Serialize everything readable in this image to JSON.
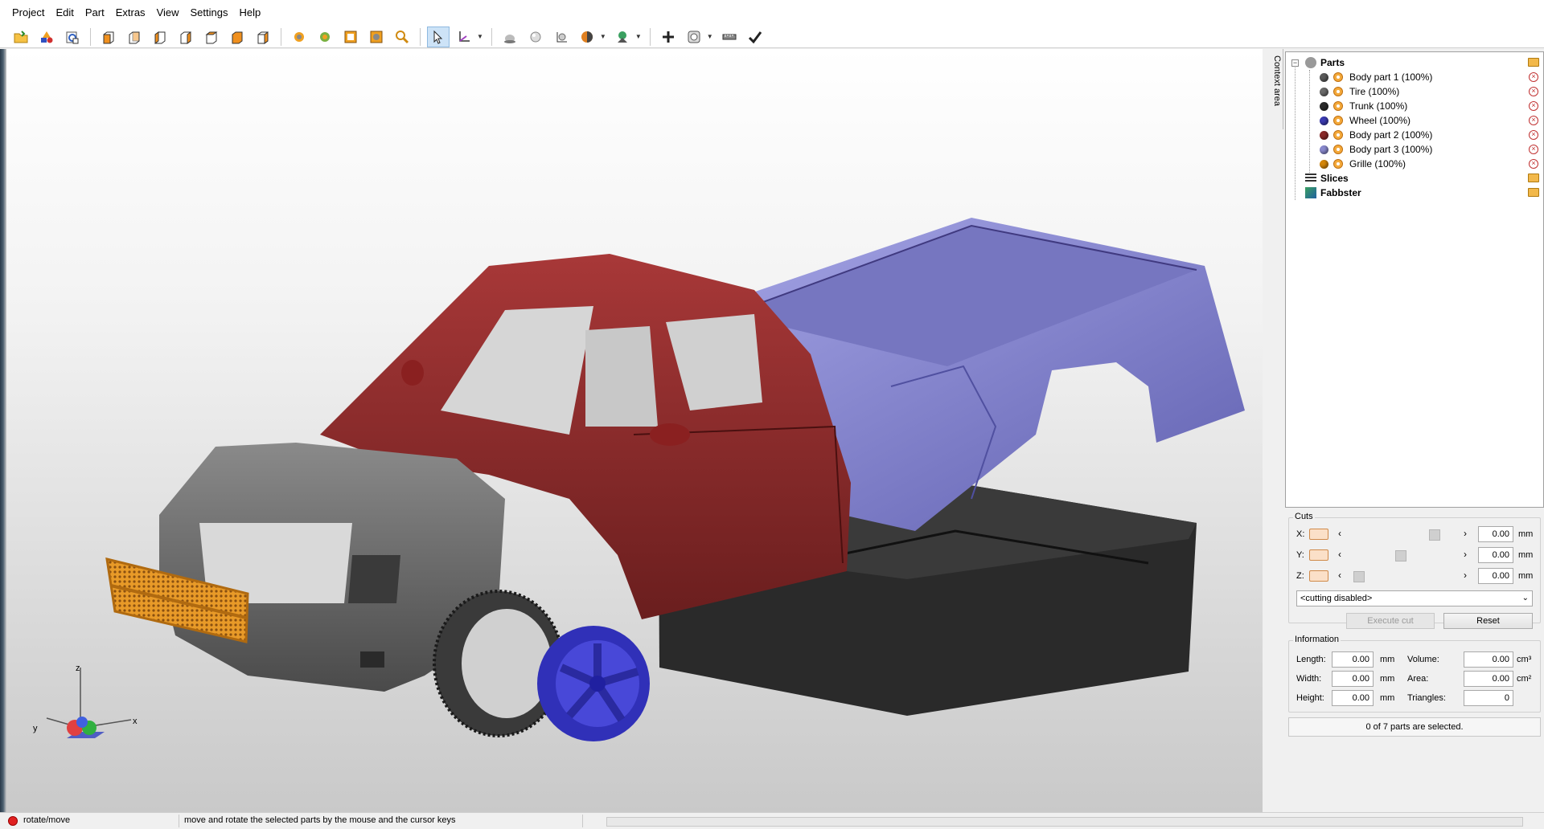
{
  "menu": {
    "items": [
      "Project",
      "Edit",
      "Part",
      "Extras",
      "View",
      "Settings",
      "Help"
    ]
  },
  "toolbar": {
    "groups": [
      [
        "open-folder-icon",
        "add-shapes-icon",
        "import-icon"
      ],
      [
        "view-front-cube-icon",
        "view-back-cube-icon",
        "view-left-cube-icon",
        "view-right-cube-icon",
        "view-top-cube-icon",
        "view-bottom-cube-icon",
        "view-iso-cube-icon"
      ],
      [
        "rotate-view-icon",
        "pan-view-icon",
        "zoom-fit-icon",
        "zoom-selection-icon",
        "zoom-icon"
      ],
      [
        "select-cursor-icon",
        "axis-move-icon"
      ],
      [
        "sphere-icon",
        "sphere-shaded-icon",
        "transform-icon",
        "shading-mode-icon",
        "lighting-icon"
      ],
      [
        "add-icon",
        "hollow-icon",
        "measure-ruler-icon",
        "check-icon"
      ]
    ]
  },
  "context_area": {
    "label": "Context area"
  },
  "tree": {
    "root_label": "Parts",
    "parts": [
      {
        "label": "Body part 1 (100%)",
        "color": "#5a5a5a"
      },
      {
        "label": "Tire (100%)",
        "color": "#6a6a6a"
      },
      {
        "label": "Trunk (100%)",
        "color": "#2a2a2a"
      },
      {
        "label": "Wheel (100%)",
        "color": "#3a3ab0"
      },
      {
        "label": "Body part 2 (100%)",
        "color": "#8a2a2a"
      },
      {
        "label": "Body part 3 (100%)",
        "color": "#8888cc"
      },
      {
        "label": "Grille (100%)",
        "color": "#d4860a"
      }
    ],
    "slices_label": "Slices",
    "fabbster_label": "Fabbster"
  },
  "cuts": {
    "title": "Cuts",
    "x": {
      "label": "X:",
      "value": "0.00",
      "unit": "mm",
      "position": 0.95
    },
    "y": {
      "label": "Y:",
      "value": "0.00",
      "unit": "mm",
      "position": 0.55
    },
    "z": {
      "label": "Z:",
      "value": "0.00",
      "unit": "mm",
      "position": 0.05
    },
    "mode": "<cutting disabled>",
    "execute_label": "Execute cut",
    "reset_label": "Reset"
  },
  "information": {
    "title": "Information",
    "length_label": "Length:",
    "length": "0.00",
    "width_label": "Width:",
    "width": "0.00",
    "height_label": "Height:",
    "height": "0.00",
    "unit_mm": "mm",
    "volume_label": "Volume:",
    "volume": "0.00",
    "volume_unit": "cm³",
    "area_label": "Area:",
    "area": "0.00",
    "area_unit": "cm²",
    "triangles_label": "Triangles:",
    "triangles": "0"
  },
  "selection_text": "0 of 7 parts are selected.",
  "axes": {
    "x": "x",
    "y": "y",
    "z": "z"
  },
  "status": {
    "mode": "rotate/move",
    "message": "move and rotate the selected parts by the mouse and the cursor keys"
  }
}
